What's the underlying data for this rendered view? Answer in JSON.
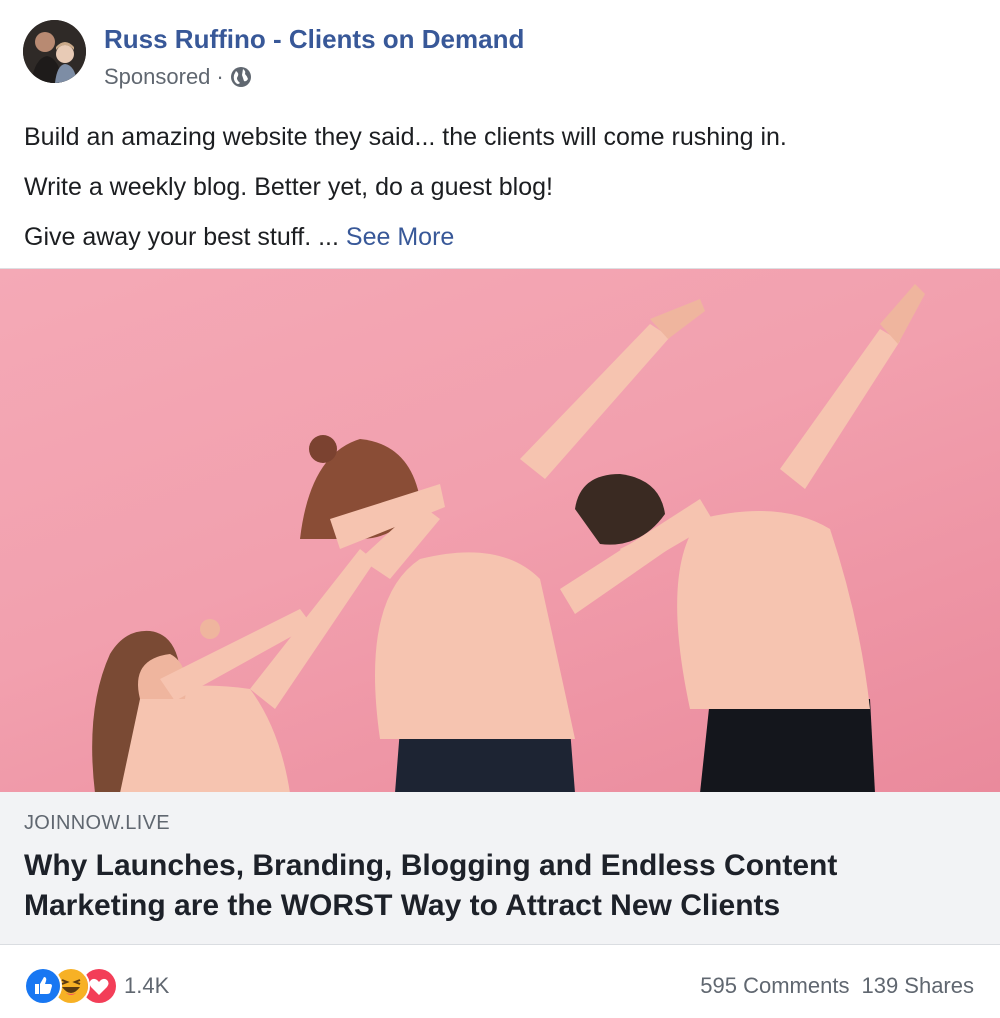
{
  "post": {
    "page_name": "Russ Ruffino - Clients on Demand",
    "sponsored_label": "Sponsored",
    "separator": "·",
    "privacy_icon": "globe-icon",
    "text_lines": [
      "Build an amazing website they said... the clients will come rushing in.",
      "Write a weekly blog. Better yet, do a guest blog!",
      "Give away your best stuff. ..."
    ],
    "see_more_label": "See More"
  },
  "link_preview": {
    "domain": "JOINNOW.LIVE",
    "headline_line1": "Why Launches, Branding, Blogging and Endless Content",
    "headline_line2": "Marketing are the WORST Way to Attract New Clients"
  },
  "engagement": {
    "reaction_icons": [
      "like-icon",
      "haha-icon",
      "love-icon"
    ],
    "reaction_count": "1.4K",
    "comments": "595 Comments",
    "shares": "139 Shares"
  },
  "colors": {
    "link_blue": "#385898",
    "photo_background": "#f2a0ae",
    "like_blue": "#1877f2",
    "love_red": "#f33e58",
    "haha_yellow": "#f7b125"
  }
}
